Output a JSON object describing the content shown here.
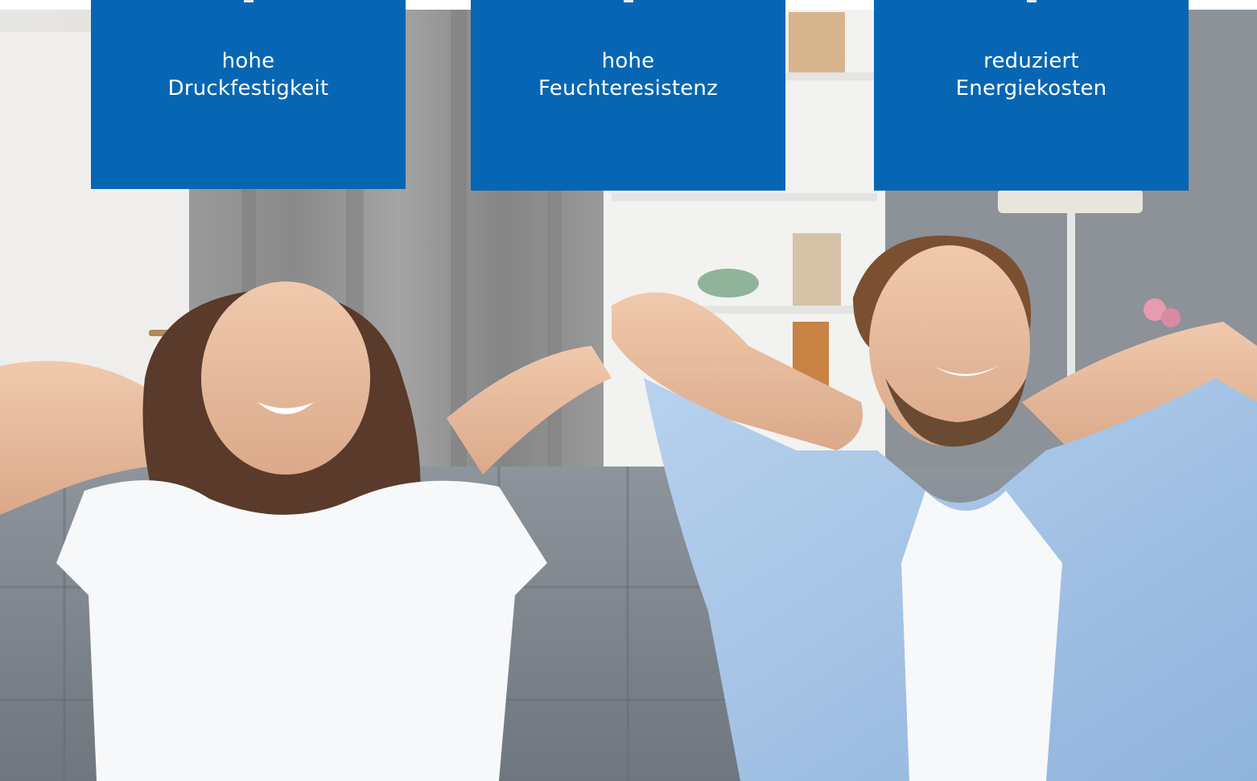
{
  "colors": {
    "card_blue": "#0766b3",
    "card_text": "#ffffff"
  },
  "features": [
    {
      "line1": "hohe",
      "line2": "Druckfestigkeit"
    },
    {
      "line1": "hohe",
      "line2": "Feuchteresistenz"
    },
    {
      "line1": "reduziert",
      "line2": "Energiekosten"
    }
  ],
  "photo": {
    "icon": "living-room-couple-photo"
  }
}
